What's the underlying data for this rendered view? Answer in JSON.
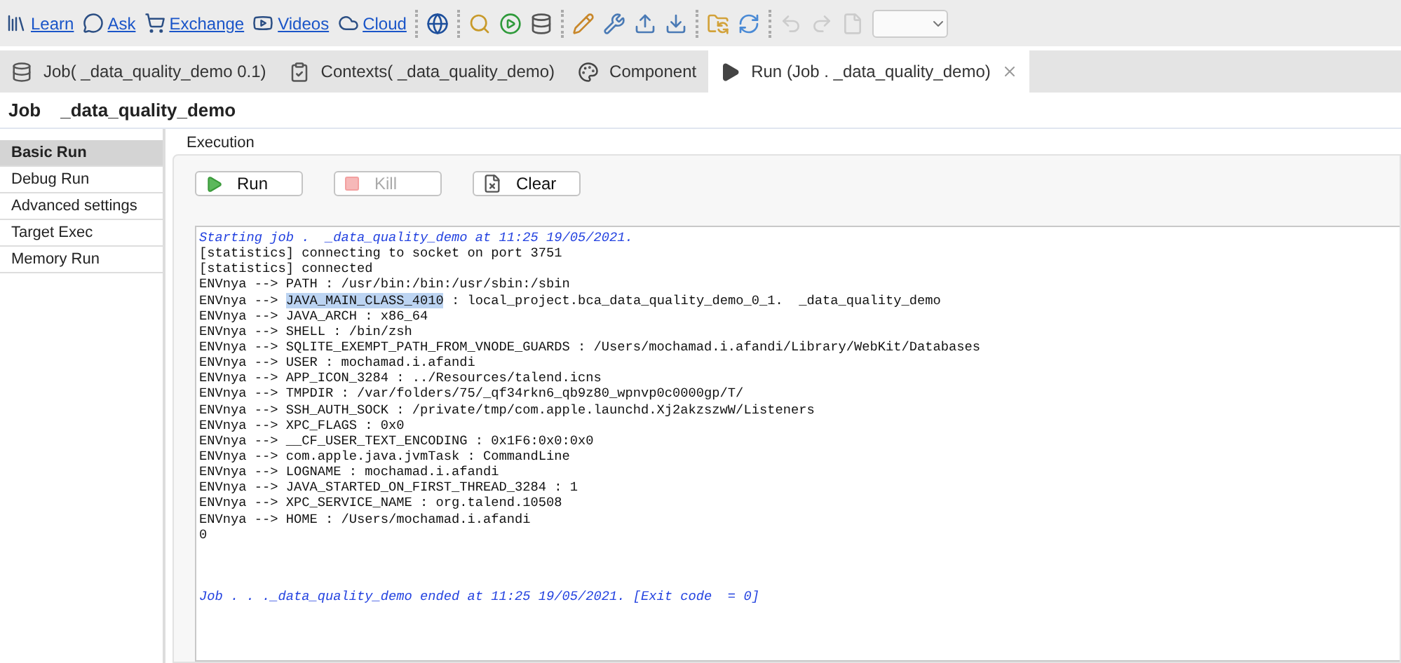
{
  "toolbar": {
    "links": [
      {
        "label": "Learn",
        "kind": "library"
      },
      {
        "label": "Ask",
        "kind": "chat"
      },
      {
        "label": "Exchange",
        "kind": "cart"
      },
      {
        "label": "Videos",
        "kind": "video"
      },
      {
        "label": "Cloud",
        "kind": "cloud"
      }
    ]
  },
  "tabs": [
    {
      "label": "Job( _data_quality_demo 0.1)",
      "kind": "job",
      "selected": false
    },
    {
      "label": "Contexts( _data_quality_demo)",
      "kind": "contexts",
      "selected": false
    },
    {
      "label": "Component",
      "kind": "component",
      "selected": false
    },
    {
      "label": "Run (Job . _data_quality_demo)",
      "kind": "run",
      "selected": true
    }
  ],
  "job_title": {
    "label": "Job",
    "name": "_data_quality_demo"
  },
  "sidebar": {
    "items": [
      {
        "label": "Basic Run",
        "selected": true
      },
      {
        "label": "Debug Run",
        "selected": false
      },
      {
        "label": "Advanced settings",
        "selected": false
      },
      {
        "label": "Target Exec",
        "selected": false
      },
      {
        "label": "Memory Run",
        "selected": false
      }
    ]
  },
  "execution": {
    "title": "Execution",
    "buttons": [
      {
        "label": "Run",
        "kind": "run",
        "disabled": false
      },
      {
        "label": "Kill",
        "kind": "kill",
        "disabled": true
      },
      {
        "label": "Clear",
        "kind": "clear",
        "disabled": false
      }
    ]
  },
  "console": {
    "lines": [
      {
        "kind": "info",
        "text": "Starting job .  _data_quality_demo at 11:25 19/05/2021."
      },
      {
        "kind": "plain",
        "text": "[statistics] connecting to socket on port 3751"
      },
      {
        "kind": "plain",
        "text": "[statistics] connected"
      },
      {
        "kind": "plain",
        "text": "ENVnya --> PATH : /usr/bin:/bin:/usr/sbin:/sbin"
      },
      {
        "kind": "plain",
        "prefix": "ENVnya --> ",
        "selection": "JAVA_MAIN_CLASS_4010",
        "text": " : local_project.bca_data_quality_demo_0_1.  _data_quality_demo"
      },
      {
        "kind": "plain",
        "text": "ENVnya --> JAVA_ARCH : x86_64"
      },
      {
        "kind": "plain",
        "text": "ENVnya --> SHELL : /bin/zsh"
      },
      {
        "kind": "plain",
        "text": "ENVnya --> SQLITE_EXEMPT_PATH_FROM_VNODE_GUARDS : /Users/mochamad.i.afandi/Library/WebKit/Databases"
      },
      {
        "kind": "plain",
        "text": "ENVnya --> USER : mochamad.i.afandi"
      },
      {
        "kind": "plain",
        "text": "ENVnya --> APP_ICON_3284 : ../Resources/talend.icns"
      },
      {
        "kind": "plain",
        "text": "ENVnya --> TMPDIR : /var/folders/75/_qf34rkn6_qb9z80_wpnvp0c0000gp/T/"
      },
      {
        "kind": "plain",
        "text": "ENVnya --> SSH_AUTH_SOCK : /private/tmp/com.apple.launchd.Xj2akzszwW/Listeners"
      },
      {
        "kind": "plain",
        "text": "ENVnya --> XPC_FLAGS : 0x0"
      },
      {
        "kind": "plain",
        "text": "ENVnya --> __CF_USER_TEXT_ENCODING : 0x1F6:0x0:0x0"
      },
      {
        "kind": "plain",
        "text": "ENVnya --> com.apple.java.jvmTask : CommandLine"
      },
      {
        "kind": "plain",
        "text": "ENVnya --> LOGNAME : mochamad.i.afandi"
      },
      {
        "kind": "plain",
        "text": "ENVnya --> JAVA_STARTED_ON_FIRST_THREAD_3284 : 1"
      },
      {
        "kind": "plain",
        "text": "ENVnya --> XPC_SERVICE_NAME : org.talend.10508"
      },
      {
        "kind": "plain",
        "text": "ENVnya --> HOME : /Users/mochamad.i.afandi"
      },
      {
        "kind": "plain",
        "text": "0"
      },
      {
        "kind": "blank"
      },
      {
        "kind": "blank"
      },
      {
        "kind": "blank"
      },
      {
        "kind": "info",
        "text": "Job . . ._data_quality_demo ended at 11:25 19/05/2021. [Exit code  = 0]"
      }
    ]
  }
}
